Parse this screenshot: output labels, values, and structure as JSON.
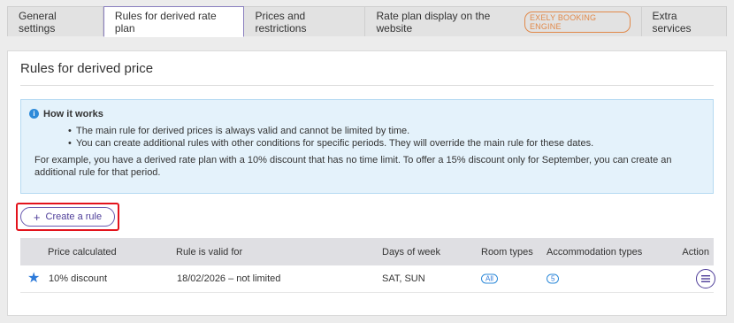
{
  "tabs": [
    {
      "label": "General settings"
    },
    {
      "label": "Rules for derived rate plan",
      "active": true
    },
    {
      "label": "Prices and restrictions"
    },
    {
      "label": "Rate plan display on the website",
      "badge": "EXELY BOOKING ENGINE"
    },
    {
      "label": "Extra services"
    }
  ],
  "panel": {
    "title": "Rules for derived price"
  },
  "info": {
    "icon": "info-icon",
    "icon_glyph": "i",
    "title": "How it works",
    "bullets": [
      "The main rule for derived prices is always valid and cannot be limited by time.",
      "You can create additional rules with other conditions for specific periods. They will override the main rule for these dates."
    ],
    "example": "For example, you have a derived rate plan with a 10% discount that has no time limit. To offer a 15% discount only for September, you can create an additional rule for that period."
  },
  "create_button": {
    "icon": "plus-icon",
    "plus": "+",
    "label": "Create a rule"
  },
  "table": {
    "headers": {
      "price": "Price calculated",
      "valid": "Rule is valid for",
      "days": "Days of week",
      "rooms": "Room types",
      "accommodation": "Accommodation types",
      "action": "Action"
    },
    "rows": [
      {
        "main_rule_icon": "star-icon",
        "star": "★",
        "price": "10% discount",
        "valid": "18/02/2026 – not limited",
        "days": "SAT, SUN",
        "rooms": "All",
        "accommodation": "5",
        "action_icon": "menu-icon"
      }
    ]
  },
  "colors": {
    "accent": "#4e3d99",
    "info_bg": "#e4f2fb",
    "info_icon": "#2d8ad9",
    "badge": "#e1894a",
    "highlight": "#e3131c"
  }
}
